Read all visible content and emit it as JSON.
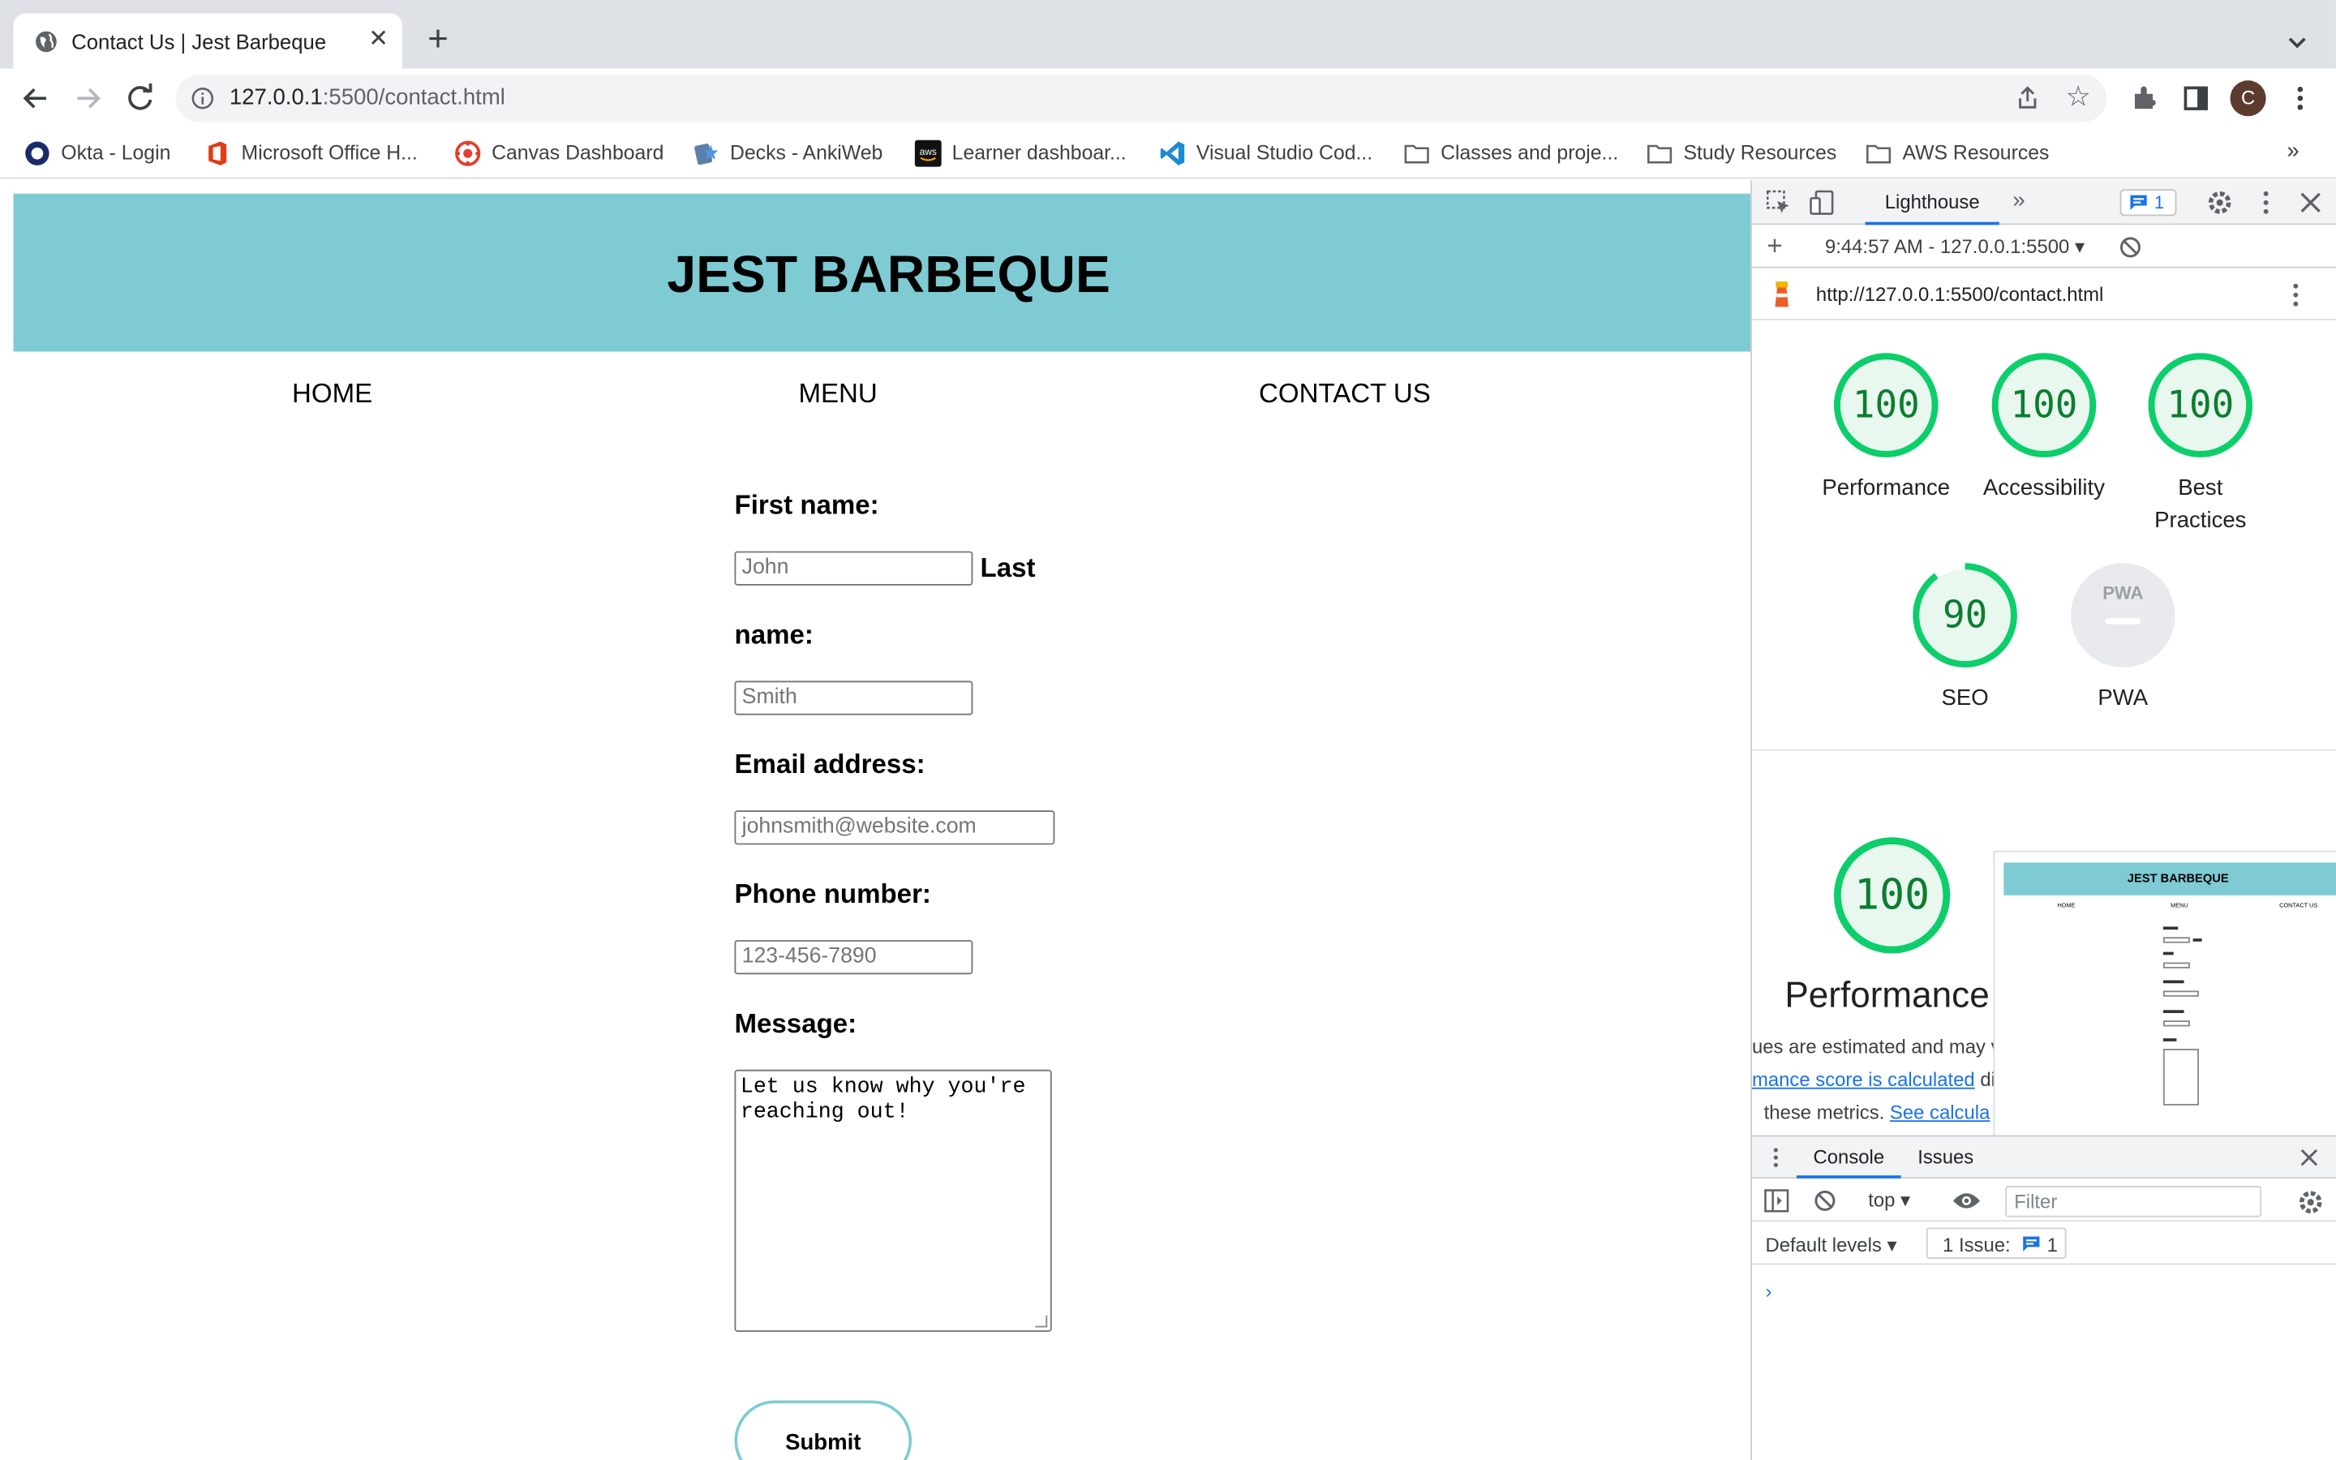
{
  "browser": {
    "tab_title": "Contact Us | Jest Barbeque",
    "url_host": "127.0.0.1",
    "url_rest": ":5500/contact.html",
    "avatar_letter": "C",
    "bookmarks": [
      {
        "label": "Okta - Login",
        "icon": "okta-icon"
      },
      {
        "label": "Microsoft Office H...",
        "icon": "office-icon"
      },
      {
        "label": "Canvas Dashboard",
        "icon": "canvas-icon"
      },
      {
        "label": "Decks - AnkiWeb",
        "icon": "anki-icon"
      },
      {
        "label": "Learner dashboar...",
        "icon": "aws-icon"
      },
      {
        "label": "Visual Studio Cod...",
        "icon": "vscode-icon"
      },
      {
        "label": "Classes and proje...",
        "icon": "folder-icon"
      },
      {
        "label": "Study Resources",
        "icon": "folder-icon"
      },
      {
        "label": "AWS Resources",
        "icon": "folder-icon"
      }
    ],
    "bookmarks_overflow": "»"
  },
  "site": {
    "title": "JEST BARBEQUE",
    "banner_color": "#7ecbd3",
    "nav": [
      "HOME",
      "MENU",
      "CONTACT US"
    ],
    "form": {
      "first_label": "First name:",
      "first_placeholder": "John",
      "last_label_1": "Last",
      "last_label_2": "name:",
      "last_placeholder": "Smith",
      "email_label": "Email address:",
      "email_placeholder": "johnsmith@website.com",
      "phone_label": "Phone number:",
      "phone_placeholder": "123-456-7890",
      "message_label": "Message:",
      "message_line1": "Let us know why you're",
      "message_line2": "reaching out!",
      "submit_label": "Submit"
    }
  },
  "devtools": {
    "active_tab": "Lighthouse",
    "overflow": "»",
    "issues_count": "1",
    "report_selector": "9:44:57 AM - 127.0.0.1:5500",
    "report_url": "http://127.0.0.1:5500/contact.html",
    "scores": [
      {
        "label": "Performance",
        "value": "100",
        "fraction": 1.0
      },
      {
        "label": "Accessibility",
        "value": "100",
        "fraction": 1.0
      },
      {
        "label_lines": [
          "Best",
          "Practices"
        ],
        "value": "100",
        "fraction": 1.0
      },
      {
        "label": "SEO",
        "value": "90",
        "fraction": 0.9
      },
      {
        "label": "PWA",
        "value": "PWA",
        "fraction": 0
      }
    ],
    "big_perf_value": "100",
    "big_perf_label": "Performance",
    "perf_note_1": "ues are estimated and may va",
    "perf_note_2_link": "mance score is calculated",
    "perf_note_2_rest": " dir",
    "perf_note_3": "these metrics. ",
    "perf_note_3_link": "See calcula",
    "thumbnail": {
      "title": "JEST BARBEQUE",
      "nav": [
        "HOME",
        "MENU",
        "CONTACT US"
      ]
    },
    "good_color": "#0cce6b"
  },
  "drawer": {
    "tabs": [
      "Console",
      "Issues"
    ],
    "context": "top",
    "filter_placeholder": "Filter",
    "levels": "Default levels",
    "issue_text": "1 Issue:",
    "issue_count": "1",
    "prompt": "›"
  }
}
